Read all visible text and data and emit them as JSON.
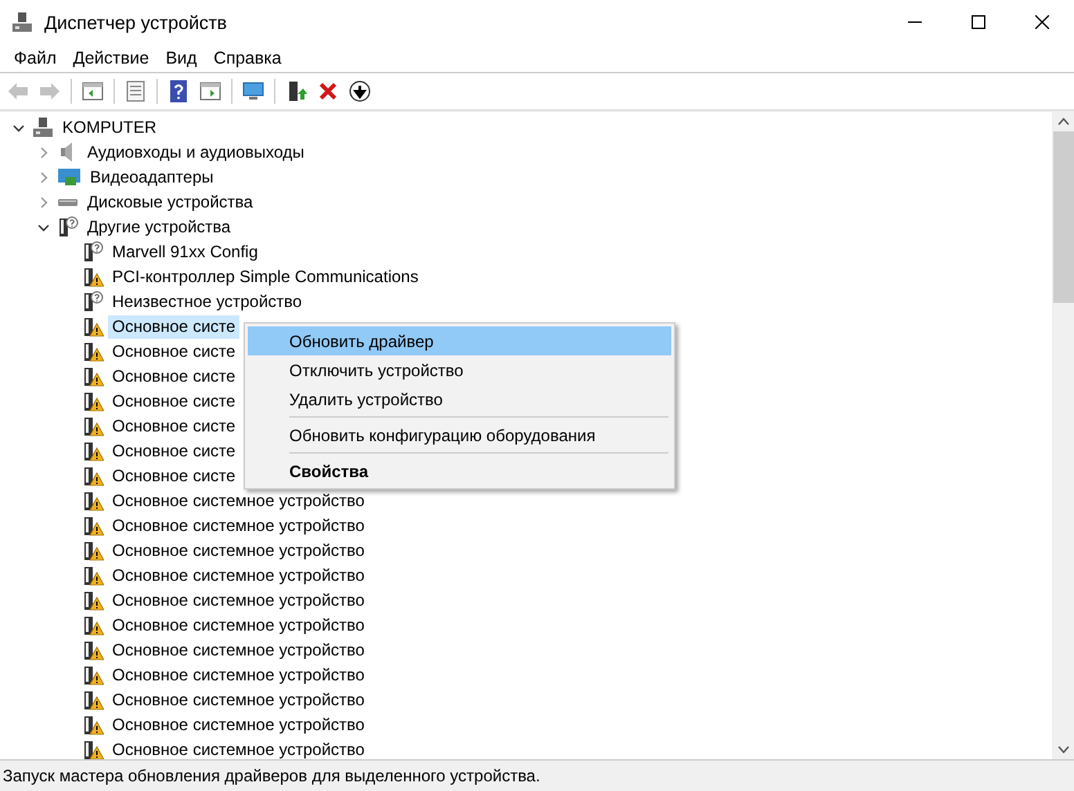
{
  "window": {
    "title": "Диспетчер устройств"
  },
  "menu_bar": [
    "Файл",
    "Действие",
    "Вид",
    "Справка"
  ],
  "toolbar": [
    {
      "kind": "back",
      "disabled": true
    },
    {
      "kind": "forward",
      "disabled": true
    },
    {
      "kind": "separator"
    },
    {
      "kind": "tree"
    },
    {
      "kind": "separator"
    },
    {
      "kind": "properties"
    },
    {
      "kind": "separator"
    },
    {
      "kind": "help"
    },
    {
      "kind": "panel"
    },
    {
      "kind": "separator"
    },
    {
      "kind": "scan"
    },
    {
      "kind": "separator"
    },
    {
      "kind": "update"
    },
    {
      "kind": "remove"
    },
    {
      "kind": "download"
    }
  ],
  "tree": [
    {
      "label": "KOMPUTER",
      "kind": "computer",
      "expanded": true,
      "selected": false,
      "children": [
        {
          "label": "Аудиовходы и аудиовыходы",
          "kind": "audio",
          "expanded": false,
          "selected": false
        },
        {
          "label": "Видеоадаптеры",
          "kind": "video",
          "expanded": false,
          "selected": false
        },
        {
          "label": "Дисковые устройства",
          "kind": "disk",
          "expanded": false,
          "selected": false
        },
        {
          "label": "Другие устройства",
          "kind": "unknown",
          "expanded": true,
          "selected": false,
          "children": [
            {
              "label": "Marvell 91xx Config",
              "kind": "unknown",
              "selected": false
            },
            {
              "label": "PCI-контроллер Simple Communications",
              "kind": "warning",
              "selected": false
            },
            {
              "label": "Неизвестное устройство",
              "kind": "unknown",
              "selected": false
            },
            {
              "label": "Основное систе",
              "kind": "warning",
              "selected": true
            },
            {
              "label": "Основное систе",
              "kind": "warning",
              "selected": false
            },
            {
              "label": "Основное систе",
              "kind": "warning",
              "selected": false
            },
            {
              "label": "Основное систе",
              "kind": "warning",
              "selected": false
            },
            {
              "label": "Основное систе",
              "kind": "warning",
              "selected": false
            },
            {
              "label": "Основное систе",
              "kind": "warning",
              "selected": false
            },
            {
              "label": "Основное систе",
              "kind": "warning",
              "selected": false
            },
            {
              "label": "Основное системное устройство",
              "kind": "warning",
              "selected": false
            },
            {
              "label": "Основное системное устройство",
              "kind": "warning",
              "selected": false
            },
            {
              "label": "Основное системное устройство",
              "kind": "warning",
              "selected": false
            },
            {
              "label": "Основное системное устройство",
              "kind": "warning",
              "selected": false
            },
            {
              "label": "Основное системное устройство",
              "kind": "warning",
              "selected": false
            },
            {
              "label": "Основное системное устройство",
              "kind": "warning",
              "selected": false
            },
            {
              "label": "Основное системное устройство",
              "kind": "warning",
              "selected": false
            },
            {
              "label": "Основное системное устройство",
              "kind": "warning",
              "selected": false
            },
            {
              "label": "Основное системное устройство",
              "kind": "warning",
              "selected": false
            },
            {
              "label": "Основное системное устройство",
              "kind": "warning",
              "selected": false
            },
            {
              "label": "Основное системное устройство",
              "kind": "warning",
              "selected": false
            }
          ]
        }
      ]
    }
  ],
  "context_menu": [
    {
      "kind": "item",
      "label": "Обновить драйвер",
      "selected": true,
      "default": false
    },
    {
      "kind": "item",
      "label": "Отключить устройство",
      "selected": false,
      "default": false
    },
    {
      "kind": "item",
      "label": "Удалить устройство",
      "selected": false,
      "default": false
    },
    {
      "kind": "separator"
    },
    {
      "kind": "item",
      "label": "Обновить конфигурацию оборудования",
      "selected": false,
      "default": false
    },
    {
      "kind": "separator"
    },
    {
      "kind": "item",
      "label": "Свойства",
      "selected": false,
      "default": true
    }
  ],
  "status_bar": "Запуск мастера обновления драйверов для выделенного устройства."
}
